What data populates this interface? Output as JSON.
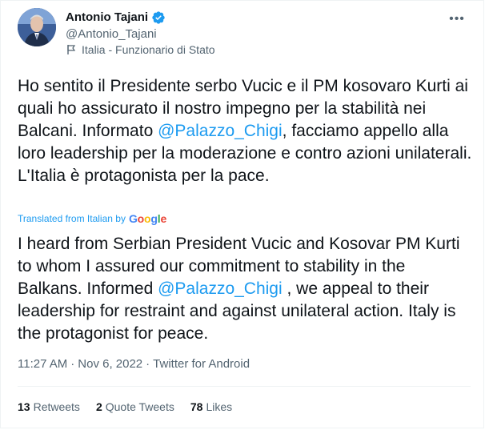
{
  "author": {
    "display_name": "Antonio Tajani",
    "handle": "@Antonio_Tajani",
    "label": "Italia - Funzionario di Stato"
  },
  "tweet": {
    "text_before_mention": "Ho sentito il Presidente serbo Vucic e il PM kosovaro Kurti ai quali ho assicurato il nostro impegno per la stabilità nei Balcani. Informato ",
    "mention": "@Palazzo_Chigi",
    "text_after_mention": ", facciamo appello alla loro leadership per la moderazione e contro azioni unilaterali. L'Italia è protagonista per la pace."
  },
  "translation": {
    "label": "Translated from Italian by",
    "provider": [
      "G",
      "o",
      "o",
      "g",
      "l",
      "e"
    ],
    "text_before_mention": "I heard from Serbian President Vucic and Kosovar PM Kurti to whom I assured our commitment to stability in the Balkans. Informed ",
    "mention": "@Palazzo_Chigi",
    "text_after_mention": " , we appeal to their leadership for restraint and against unilateral action. Italy is the protagonist for peace."
  },
  "meta": {
    "time": "11:27 AM",
    "separator": "·",
    "date": "Nov 6, 2022",
    "source": "Twitter for Android"
  },
  "stats": {
    "retweets_count": "13",
    "retweets_label": "Retweets",
    "quotes_count": "2",
    "quotes_label": "Quote Tweets",
    "likes_count": "78",
    "likes_label": "Likes"
  },
  "more_label": "•••",
  "colors": {
    "accent": "#1d9bf0",
    "text": "#0f1419",
    "secondary": "#536471"
  }
}
